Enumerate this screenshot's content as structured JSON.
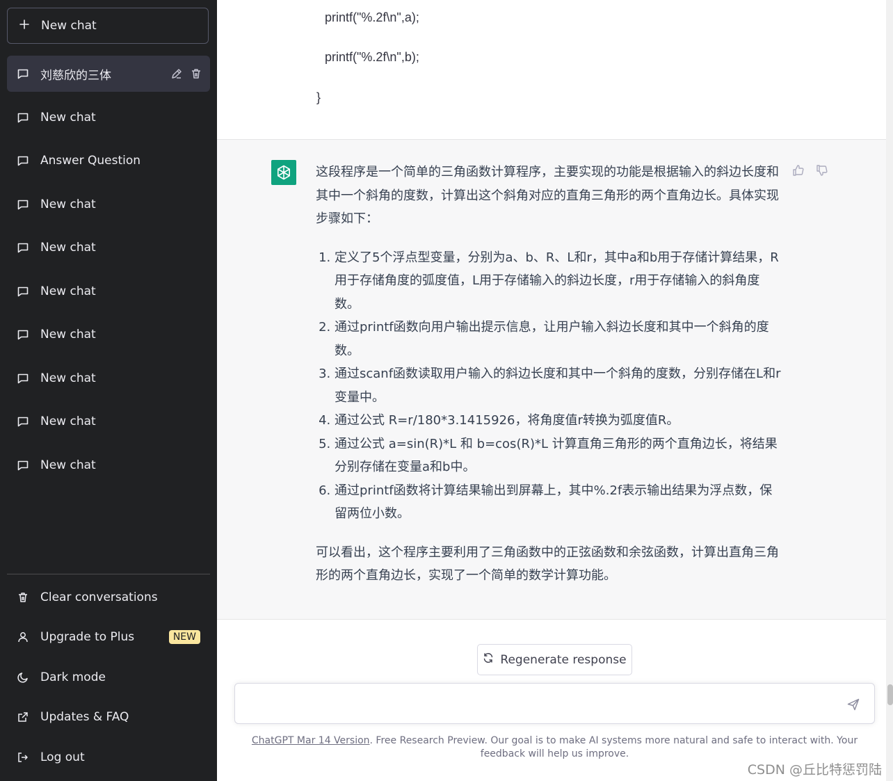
{
  "sidebar": {
    "new_chat_label": "New chat",
    "conversations": [
      {
        "label": "刘慈欣的三体",
        "active": true
      },
      {
        "label": "New chat"
      },
      {
        "label": "Answer Question"
      },
      {
        "label": "New chat"
      },
      {
        "label": "New chat"
      },
      {
        "label": "New chat"
      },
      {
        "label": "New chat"
      },
      {
        "label": "New chat"
      },
      {
        "label": "New chat"
      },
      {
        "label": "New chat"
      }
    ],
    "bottom": {
      "clear": "Clear conversations",
      "upgrade": "Upgrade to Plus",
      "upgrade_badge": "NEW",
      "dark_mode": "Dark mode",
      "updates": "Updates & FAQ",
      "logout": "Log out"
    }
  },
  "code": {
    "line1": "printf(\"%.2f\\n\",a);",
    "line2": "printf(\"%.2f\\n\",b);",
    "line3": "}"
  },
  "answer": {
    "intro": "这段程序是一个简单的三角函数计算程序，主要实现的功能是根据输入的斜边长度和其中一个斜角的度数，计算出这个斜角对应的直角三角形的两个直角边长。具体实现步骤如下：",
    "steps": [
      "定义了5个浮点型变量，分别为a、b、R、L和r，其中a和b用于存储计算结果，R用于存储角度的弧度值，L用于存储输入的斜边长度，r用于存储输入的斜角度数。",
      "通过printf函数向用户输出提示信息，让用户输入斜边长度和其中一个斜角的度数。",
      "通过scanf函数读取用户输入的斜边长度和其中一个斜角的度数，分别存储在L和r变量中。",
      "通过公式 R=r/180*3.1415926，将角度值r转换为弧度值R。",
      "通过公式 a=sin(R)*L 和 b=cos(R)*L 计算直角三角形的两个直角边长，将结果分别存储在变量a和b中。",
      "通过printf函数将计算结果输出到屏幕上，其中%.2f表示输出结果为浮点数，保留两位小数。"
    ],
    "conclusion": "可以看出，这个程序主要利用了三角函数中的正弦函数和余弦函数，计算出直角三角形的两个直角边长，实现了一个简单的数学计算功能。"
  },
  "regenerate_label": "Regenerate response",
  "composer": {
    "placeholder": ""
  },
  "footer": {
    "link": "ChatGPT Mar 14 Version",
    "text": ". Free Research Preview. Our goal is to make AI systems more natural and safe to interact with. Your feedback will help us improve."
  },
  "watermark": "CSDN @丘比特惩罚陆",
  "colors": {
    "sidebar_bg": "#202123",
    "accent": "#10a37f",
    "badge": "#fae69e"
  }
}
